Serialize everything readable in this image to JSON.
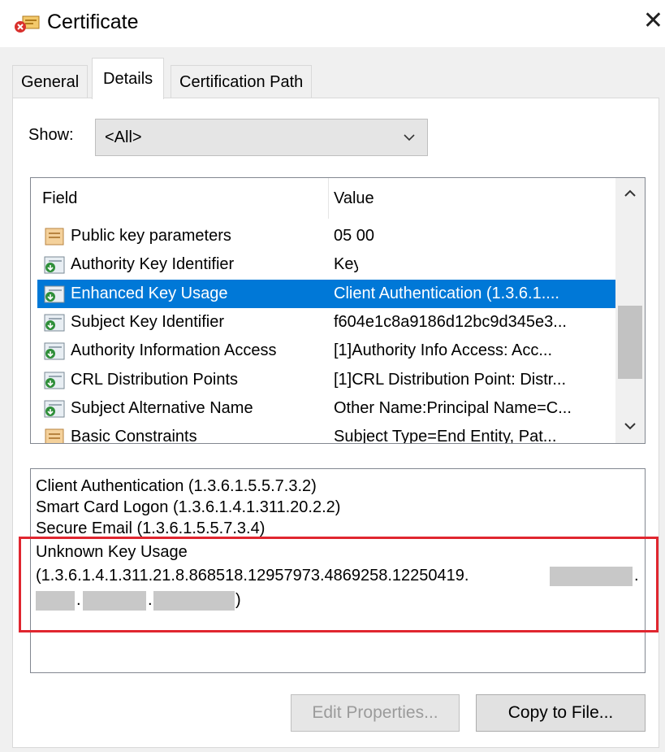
{
  "window": {
    "title": "Certificate",
    "close_glyph": "✕",
    "title_icon": "certificate-error-icon"
  },
  "tabs": [
    {
      "label": "General",
      "selected": false
    },
    {
      "label": "Details",
      "selected": true
    },
    {
      "label": "Certification Path",
      "selected": false
    }
  ],
  "show": {
    "label": "Show:",
    "selected": "<All>"
  },
  "field_list": {
    "columns": [
      "Field",
      "Value"
    ],
    "rows": [
      {
        "field": "Public key parameters",
        "value": "05 00",
        "icon": "parameters-icon",
        "selected": false
      },
      {
        "field": "Authority Key Identifier",
        "value": "KeyID=",
        "icon": "extension-icon",
        "selected": false
      },
      {
        "field": "Enhanced Key Usage",
        "value": "Client Authentication (1.3.6.1....",
        "icon": "extension-icon",
        "selected": true
      },
      {
        "field": "Subject Key Identifier",
        "value": "f604e1c8a9186d12bc9d345e3...",
        "icon": "extension-icon",
        "selected": false
      },
      {
        "field": "Authority Information Access",
        "value": "[1]Authority Info Access: Acc...",
        "icon": "extension-icon",
        "selected": false
      },
      {
        "field": "CRL Distribution Points",
        "value": "[1]CRL Distribution Point: Distr...",
        "icon": "extension-icon",
        "selected": false
      },
      {
        "field": "Subject Alternative Name",
        "value": "Other Name:Principal Name=C...",
        "icon": "extension-icon",
        "selected": false
      },
      {
        "field": "Basic Constraints",
        "value": "Subject Type=End Entity, Pat...",
        "icon": "parameters-icon",
        "selected": false
      }
    ]
  },
  "detail": {
    "lines": [
      "Client Authentication (1.3.6.1.5.5.7.3.2)",
      "Smart Card Logon (1.3.6.1.4.1.311.20.2.2)",
      "Secure Email (1.3.6.1.5.5.7.3.4)",
      "Unknown Key Usage",
      "(1.3.6.1.4.1.311.21.8.868518.12957973.4869258.12250419.",
      ".",
      ".",
      ")"
    ]
  },
  "buttons": {
    "edit_properties": "Edit Properties...",
    "copy_to_file": "Copy to File..."
  },
  "colors": {
    "selection": "#0078d7",
    "highlight_border": "#e0262f",
    "redaction": "#c8c8c8"
  }
}
